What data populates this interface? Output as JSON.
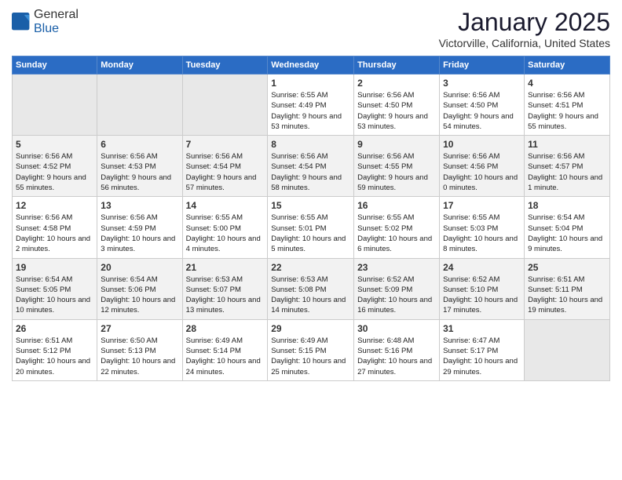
{
  "header": {
    "logo_general": "General",
    "logo_blue": "Blue",
    "month_title": "January 2025",
    "location": "Victorville, California, United States"
  },
  "weekdays": [
    "Sunday",
    "Monday",
    "Tuesday",
    "Wednesday",
    "Thursday",
    "Friday",
    "Saturday"
  ],
  "weeks": [
    [
      {
        "day": "",
        "info": ""
      },
      {
        "day": "",
        "info": ""
      },
      {
        "day": "",
        "info": ""
      },
      {
        "day": "1",
        "info": "Sunrise: 6:55 AM\nSunset: 4:49 PM\nDaylight: 9 hours and 53 minutes."
      },
      {
        "day": "2",
        "info": "Sunrise: 6:56 AM\nSunset: 4:50 PM\nDaylight: 9 hours and 53 minutes."
      },
      {
        "day": "3",
        "info": "Sunrise: 6:56 AM\nSunset: 4:50 PM\nDaylight: 9 hours and 54 minutes."
      },
      {
        "day": "4",
        "info": "Sunrise: 6:56 AM\nSunset: 4:51 PM\nDaylight: 9 hours and 55 minutes."
      }
    ],
    [
      {
        "day": "5",
        "info": "Sunrise: 6:56 AM\nSunset: 4:52 PM\nDaylight: 9 hours and 55 minutes."
      },
      {
        "day": "6",
        "info": "Sunrise: 6:56 AM\nSunset: 4:53 PM\nDaylight: 9 hours and 56 minutes."
      },
      {
        "day": "7",
        "info": "Sunrise: 6:56 AM\nSunset: 4:54 PM\nDaylight: 9 hours and 57 minutes."
      },
      {
        "day": "8",
        "info": "Sunrise: 6:56 AM\nSunset: 4:54 PM\nDaylight: 9 hours and 58 minutes."
      },
      {
        "day": "9",
        "info": "Sunrise: 6:56 AM\nSunset: 4:55 PM\nDaylight: 9 hours and 59 minutes."
      },
      {
        "day": "10",
        "info": "Sunrise: 6:56 AM\nSunset: 4:56 PM\nDaylight: 10 hours and 0 minutes."
      },
      {
        "day": "11",
        "info": "Sunrise: 6:56 AM\nSunset: 4:57 PM\nDaylight: 10 hours and 1 minute."
      }
    ],
    [
      {
        "day": "12",
        "info": "Sunrise: 6:56 AM\nSunset: 4:58 PM\nDaylight: 10 hours and 2 minutes."
      },
      {
        "day": "13",
        "info": "Sunrise: 6:56 AM\nSunset: 4:59 PM\nDaylight: 10 hours and 3 minutes."
      },
      {
        "day": "14",
        "info": "Sunrise: 6:55 AM\nSunset: 5:00 PM\nDaylight: 10 hours and 4 minutes."
      },
      {
        "day": "15",
        "info": "Sunrise: 6:55 AM\nSunset: 5:01 PM\nDaylight: 10 hours and 5 minutes."
      },
      {
        "day": "16",
        "info": "Sunrise: 6:55 AM\nSunset: 5:02 PM\nDaylight: 10 hours and 6 minutes."
      },
      {
        "day": "17",
        "info": "Sunrise: 6:55 AM\nSunset: 5:03 PM\nDaylight: 10 hours and 8 minutes."
      },
      {
        "day": "18",
        "info": "Sunrise: 6:54 AM\nSunset: 5:04 PM\nDaylight: 10 hours and 9 minutes."
      }
    ],
    [
      {
        "day": "19",
        "info": "Sunrise: 6:54 AM\nSunset: 5:05 PM\nDaylight: 10 hours and 10 minutes."
      },
      {
        "day": "20",
        "info": "Sunrise: 6:54 AM\nSunset: 5:06 PM\nDaylight: 10 hours and 12 minutes."
      },
      {
        "day": "21",
        "info": "Sunrise: 6:53 AM\nSunset: 5:07 PM\nDaylight: 10 hours and 13 minutes."
      },
      {
        "day": "22",
        "info": "Sunrise: 6:53 AM\nSunset: 5:08 PM\nDaylight: 10 hours and 14 minutes."
      },
      {
        "day": "23",
        "info": "Sunrise: 6:52 AM\nSunset: 5:09 PM\nDaylight: 10 hours and 16 minutes."
      },
      {
        "day": "24",
        "info": "Sunrise: 6:52 AM\nSunset: 5:10 PM\nDaylight: 10 hours and 17 minutes."
      },
      {
        "day": "25",
        "info": "Sunrise: 6:51 AM\nSunset: 5:11 PM\nDaylight: 10 hours and 19 minutes."
      }
    ],
    [
      {
        "day": "26",
        "info": "Sunrise: 6:51 AM\nSunset: 5:12 PM\nDaylight: 10 hours and 20 minutes."
      },
      {
        "day": "27",
        "info": "Sunrise: 6:50 AM\nSunset: 5:13 PM\nDaylight: 10 hours and 22 minutes."
      },
      {
        "day": "28",
        "info": "Sunrise: 6:49 AM\nSunset: 5:14 PM\nDaylight: 10 hours and 24 minutes."
      },
      {
        "day": "29",
        "info": "Sunrise: 6:49 AM\nSunset: 5:15 PM\nDaylight: 10 hours and 25 minutes."
      },
      {
        "day": "30",
        "info": "Sunrise: 6:48 AM\nSunset: 5:16 PM\nDaylight: 10 hours and 27 minutes."
      },
      {
        "day": "31",
        "info": "Sunrise: 6:47 AM\nSunset: 5:17 PM\nDaylight: 10 hours and 29 minutes."
      },
      {
        "day": "",
        "info": ""
      }
    ]
  ]
}
